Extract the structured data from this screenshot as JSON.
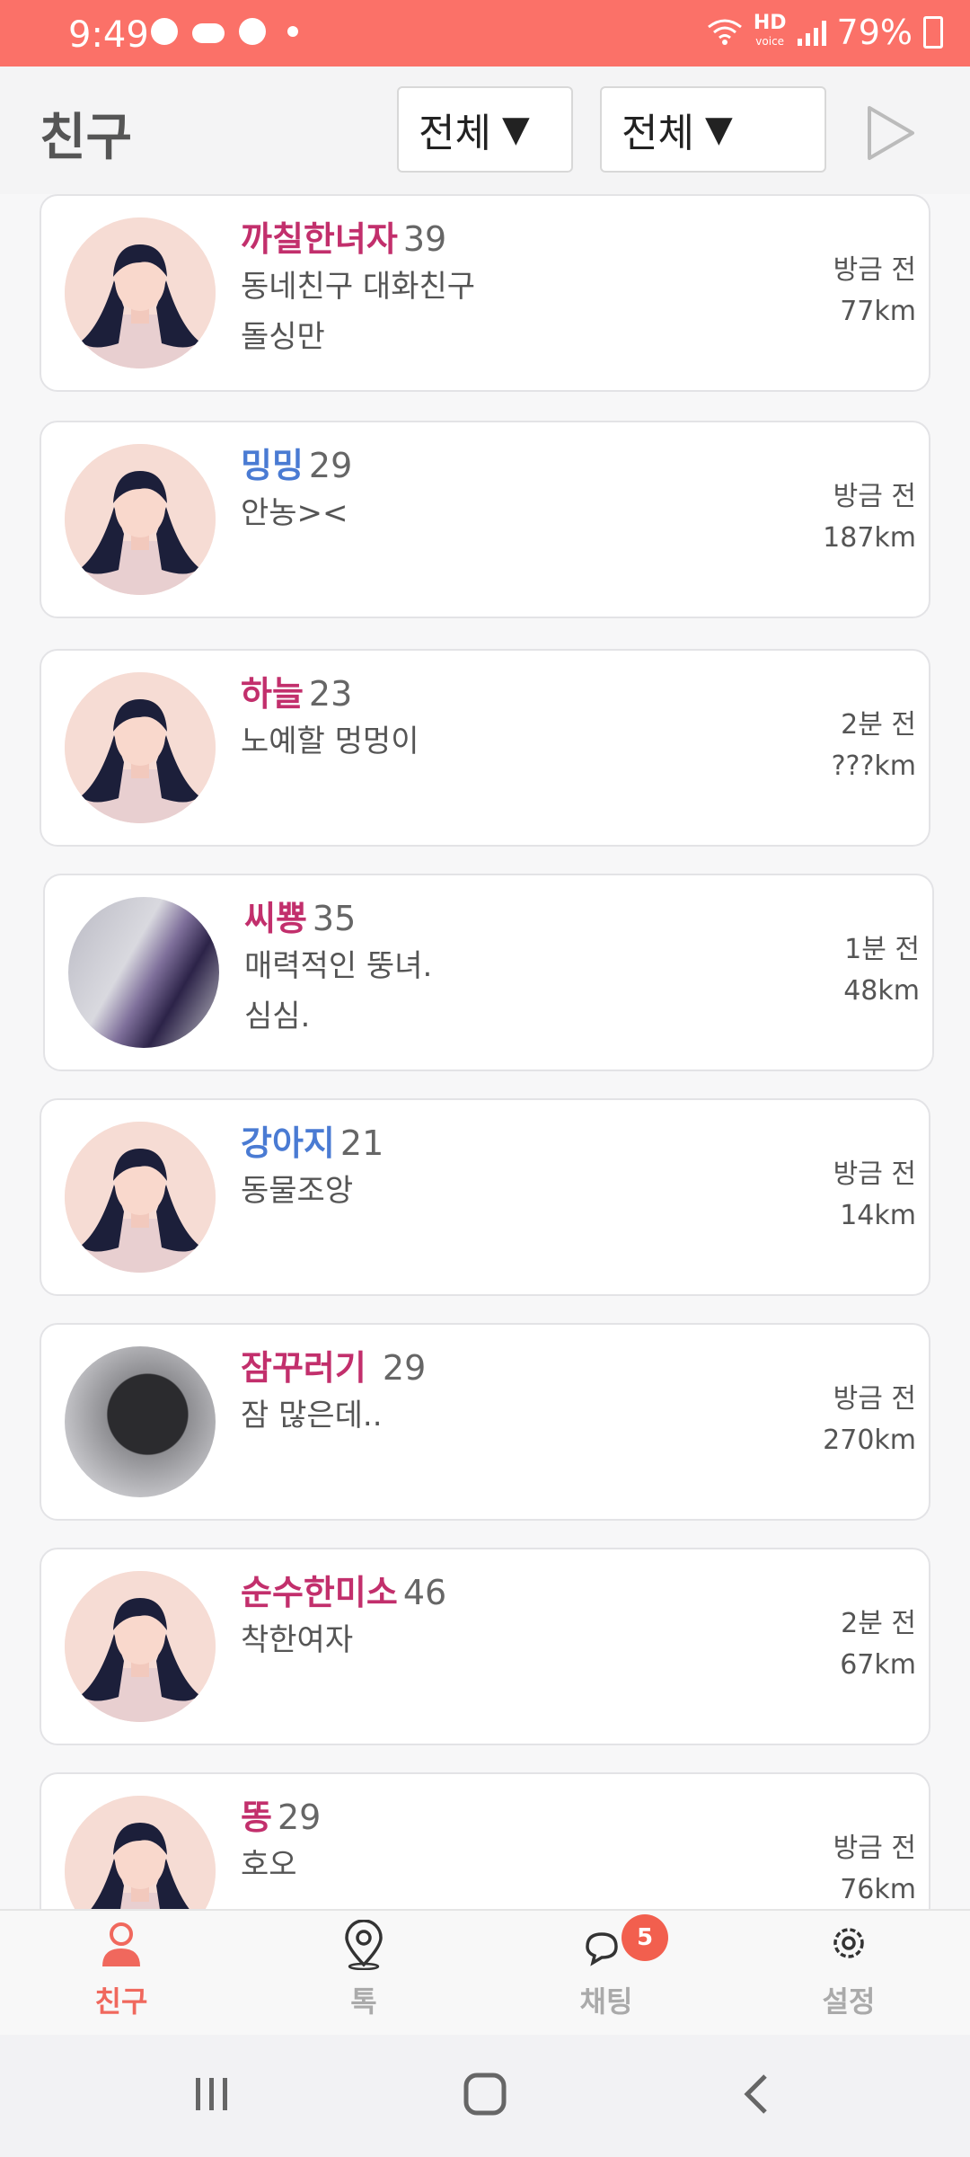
{
  "status_bar": {
    "time": "9:49",
    "hd_label": "HD",
    "voice_label": "voice",
    "battery": "79%"
  },
  "header": {
    "title": "친구",
    "filter1": "전체",
    "filter2": "전체",
    "arrow": "▼",
    "send_icon": "play-icon"
  },
  "friends": [
    {
      "name": "까칠한녀자",
      "age": "39",
      "status": "동네친구 대화친구",
      "status2": "돌싱만",
      "time": "방금 전",
      "distance": "77km",
      "name_color": "pink",
      "avatar": "default-female-avatar"
    },
    {
      "name": "밍밍",
      "age": "29",
      "status": "안농><",
      "status2": "",
      "time": "방금 전",
      "distance": "187km",
      "name_color": "blue",
      "avatar": "default-female-avatar"
    },
    {
      "name": "하늘",
      "age": "23",
      "status": "노예할 멍멍이",
      "status2": "",
      "time": "2분 전",
      "distance": "???km",
      "name_color": "pink",
      "avatar": "default-female-avatar"
    },
    {
      "name": "씨뿅",
      "age": "35",
      "status": "매력적인 뚱녀.",
      "status2": "심심.",
      "time": "1분 전",
      "distance": "48km",
      "name_color": "pink",
      "avatar": "photo-avatar"
    },
    {
      "name": "강아지",
      "age": "21",
      "status": "동물조앙",
      "status2": "",
      "time": "방금 전",
      "distance": "14km",
      "name_color": "blue",
      "avatar": "default-female-avatar"
    },
    {
      "name": "잠꾸러기",
      "age": " 29",
      "status": "잠 많은데..",
      "status2": "",
      "time": "방금 전",
      "distance": "270km",
      "name_color": "pink",
      "avatar": "photo-avatar"
    },
    {
      "name": "순수한미소",
      "age": "46",
      "status": "착한여자",
      "status2": "",
      "time": "2분 전",
      "distance": "67km",
      "name_color": "pink",
      "avatar": "default-female-avatar"
    },
    {
      "name": "똥",
      "age": "29",
      "status": "호오",
      "status2": "",
      "time": "방금 전",
      "distance": "76km",
      "name_color": "pink",
      "avatar": "default-female-avatar"
    }
  ],
  "bottom_nav": [
    {
      "label": "친구",
      "icon": "person-icon",
      "active": true
    },
    {
      "label": "톡",
      "icon": "location-pin-icon",
      "active": false
    },
    {
      "label": "채팅",
      "icon": "chat-bubbles-icon",
      "active": false,
      "badge": "5"
    },
    {
      "label": "설정",
      "icon": "gear-icon",
      "active": false
    }
  ],
  "colors": {
    "accent": "#fb7168",
    "name_pink": "#c22f6c",
    "name_blue": "#4a7bd3",
    "badge": "#f25f4e"
  }
}
